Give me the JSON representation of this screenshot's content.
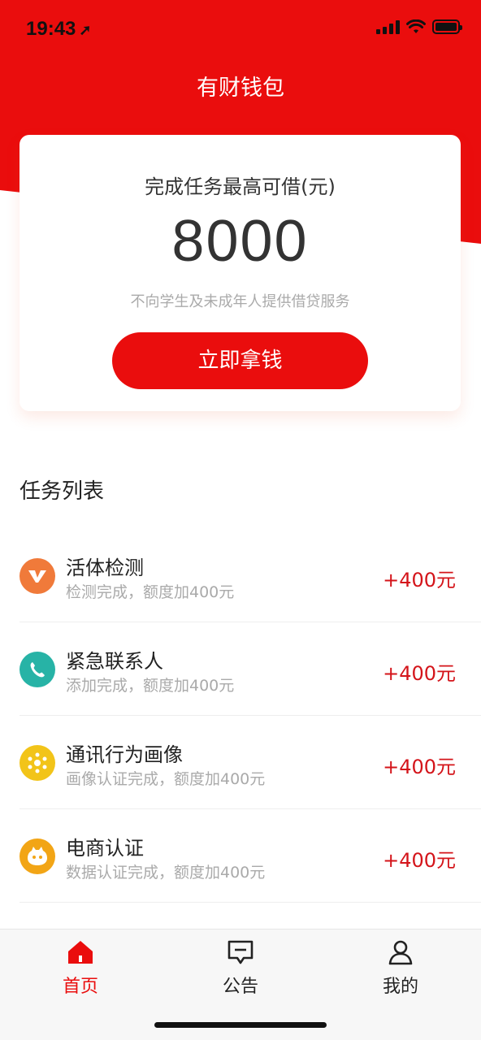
{
  "status_bar": {
    "time": "19:43"
  },
  "header": {
    "title": "有财钱包"
  },
  "card": {
    "subtitle": "完成任务最高可借(元)",
    "amount": "8000",
    "note": "不向学生及未成年人提供借贷服务",
    "cta_label": "立即拿钱"
  },
  "tasks_section": {
    "title": "任务列表"
  },
  "tasks": [
    {
      "name": "活体检测",
      "desc": "检测完成，额度加400元",
      "reward": "+400元",
      "icon": "v-icon",
      "color": "#f07a3a"
    },
    {
      "name": "紧急联系人",
      "desc": "添加完成，额度加400元",
      "reward": "+400元",
      "icon": "phone-icon",
      "color": "#27b3a6"
    },
    {
      "name": "通讯行为画像",
      "desc": "画像认证完成，额度加400元",
      "reward": "+400元",
      "icon": "network-icon",
      "color": "#f2c419"
    },
    {
      "name": "电商认证",
      "desc": "数据认证完成，额度加400元",
      "reward": "+400元",
      "icon": "face-icon",
      "color": "#f2a516"
    }
  ],
  "tabbar": {
    "home": "首页",
    "notice": "公告",
    "mine": "我的"
  },
  "colors": {
    "brand_red": "#ea0d0d",
    "reward_red": "#d4141a"
  }
}
